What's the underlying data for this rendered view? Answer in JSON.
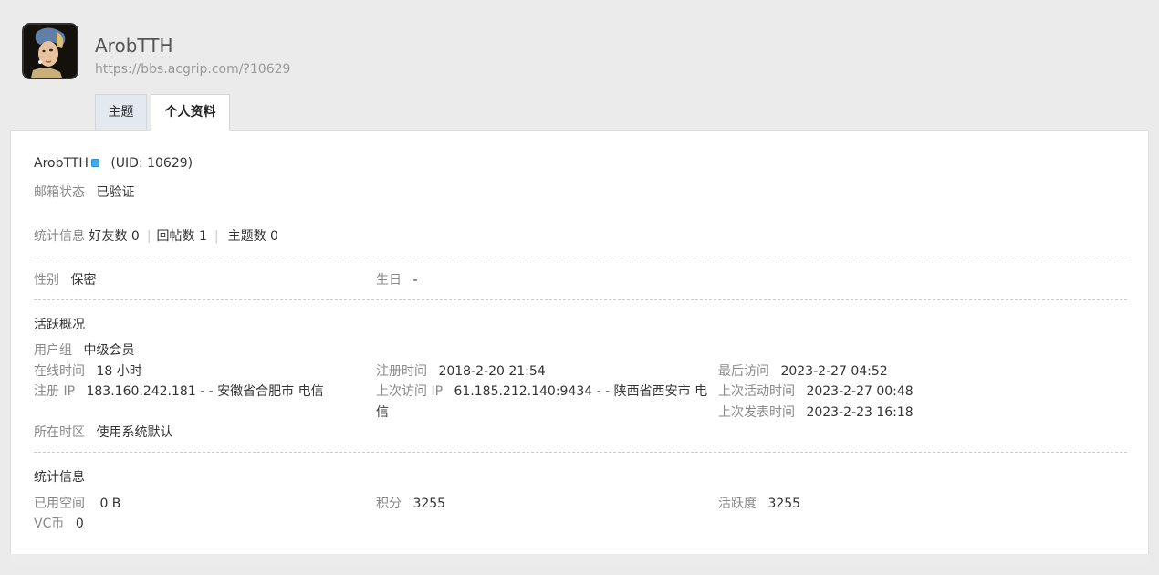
{
  "header": {
    "username": "ArobTTH",
    "url": "https://bbs.acgrip.com/?10629"
  },
  "tabs": [
    {
      "label": "主题"
    },
    {
      "label": "个人资料"
    }
  ],
  "profile": {
    "name": "ArobTTH",
    "uid_text": "(UID: 10629)",
    "email_status_label": "邮箱状态",
    "email_status_value": "已验证",
    "stats_label": "统计信息",
    "friends": "好友数 0",
    "replies": "回帖数 1",
    "topics": "主题数 0"
  },
  "basic": {
    "gender_label": "性别",
    "gender_value": "保密",
    "birthday_label": "生日",
    "birthday_value": "-"
  },
  "activity": {
    "title": "活跃概况",
    "usergroup_label": "用户组",
    "usergroup_value": "中级会员",
    "online_label": "在线时间",
    "online_value": "18 小时",
    "regtime_label": "注册时间",
    "regtime_value": "2018-2-20 21:54",
    "lastvisit_label": "最后访问",
    "lastvisit_value": "2023-2-27 04:52",
    "regip_label": "注册 IP",
    "regip_value": "183.160.242.181 - - 安徽省合肥市 电信",
    "lastip_label": "上次访问 IP",
    "lastip_value_line1": "61.185.212.140:9434 - - 陕西省西安市 电",
    "lastip_value_line2": "信",
    "lastactive_label": "上次活动时间",
    "lastactive_value": "2023-2-27 00:48",
    "lastpost_label": "上次发表时间",
    "lastpost_value": "2023-2-23 16:18",
    "timezone_label": "所在时区",
    "timezone_value": "使用系统默认"
  },
  "stats": {
    "title": "统计信息",
    "space_label": "已用空间",
    "space_value": "0 B",
    "credits_label": "积分",
    "credits_value": "3255",
    "activity_label": "活跃度",
    "activity_value": "3255",
    "vc_label": "VC币",
    "vc_value": "0"
  },
  "colors": {
    "background": "#ebebeb",
    "panel": "#ffffff",
    "verified_badge": "#4aa8e8"
  }
}
